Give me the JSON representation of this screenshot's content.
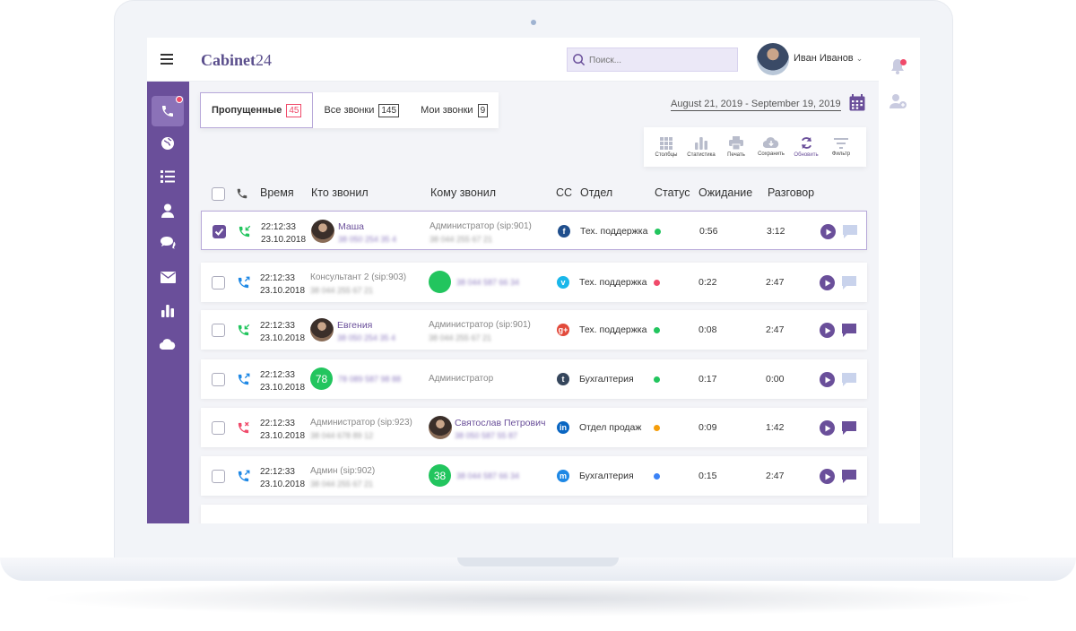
{
  "app": {
    "title": "Cabinet",
    "title_num": "24"
  },
  "search": {
    "placeholder": "Поиск..."
  },
  "user": {
    "name": "Иван Иванов"
  },
  "tabs": [
    {
      "label": "Пропущенные",
      "count": "45"
    },
    {
      "label": "Все звонки",
      "count": "145"
    },
    {
      "label": "Мои звонки",
      "count": "9"
    }
  ],
  "date_range": "August 21, 2019 - September 19, 2019",
  "toolbar": {
    "columns": "Столбцы",
    "stats": "Статистика",
    "print": "Печать",
    "save": "Сохранить",
    "refresh": "Обновить",
    "filter": "Фильтр"
  },
  "table": {
    "headers": {
      "time": "Время",
      "caller": "Кто звонил",
      "callee": "Кому звонил",
      "cc": "CC",
      "dept": "Отдел",
      "status": "Статус",
      "wait": "Ожидание",
      "talk": "Разговор"
    },
    "rows": [
      {
        "time": "22:12:33",
        "date": "23.10.2018",
        "caller_name": "Маша",
        "caller_phone": "38 050 254 35 4",
        "callee_name": "Администратор (sip:901)",
        "callee_phone": "38 044 255 67 21",
        "dept": "Тех. поддержка",
        "wait": "0:56",
        "talk": "3:12",
        "status_color": "#22c55e",
        "cc_color": "#1f4e8c",
        "cc_icon": "f",
        "direction": "incoming",
        "checked": true
      },
      {
        "time": "22:12:33",
        "date": "23.10.2018",
        "caller_name": "Консультант 2 (sip:903)",
        "caller_phone": "38 044 255 67 21",
        "callee_phone": "38 044 587 66 34",
        "dept": "Тех. поддержка",
        "wait": "0:22",
        "talk": "2:47",
        "status_color": "#f04a6a",
        "cc_color": "#1ab7ea",
        "cc_icon": "v",
        "direction": "outgoing",
        "checked": false
      },
      {
        "time": "22:12:33",
        "date": "23.10.2018",
        "caller_name": "Евгения",
        "caller_phone": "38 050 254 35 4",
        "callee_name": "Администратор (sip:901)",
        "callee_phone": "38 044 255 67 21",
        "dept": "Тех. поддержка",
        "wait": "0:08",
        "talk": "2:47",
        "status_color": "#22c55e",
        "cc_color": "#e24a3b",
        "cc_icon": "g+",
        "direction": "incoming",
        "checked": false
      },
      {
        "time": "22:12:33",
        "date": "23.10.2018",
        "caller_badge": "78",
        "caller_phone": "78 089 587 98 88",
        "callee_name": "Администратор",
        "dept": "Бухгалтерия",
        "wait": "0:17",
        "talk": "0:00",
        "status_color": "#22c55e",
        "cc_color": "#35465c",
        "cc_icon": "t",
        "direction": "outgoing",
        "checked": false
      },
      {
        "time": "22:12:33",
        "date": "23.10.2018",
        "caller_name": "Администратор (sip:923)",
        "caller_phone": "38 044 678 89 12",
        "callee_name": "Святослав Петрович",
        "callee_phone": "38 050 587 55 87",
        "dept": "Отдел продаж",
        "wait": "0:09",
        "talk": "1:42",
        "status_color": "#f59e0b",
        "cc_color": "#0a66c2",
        "cc_icon": "in",
        "direction": "missed",
        "checked": false
      },
      {
        "time": "22:12:33",
        "date": "23.10.2018",
        "caller_name": "Админ (sip:902)",
        "caller_phone": "38 044 255 67 21",
        "callee_badge": "38",
        "callee_phone": "38 044 587 66 34",
        "dept": "Бухгалтерия",
        "wait": "0:15",
        "talk": "2:47",
        "status_color": "#3b82f6",
        "cc_color": "#1e88e5",
        "cc_icon": "m",
        "direction": "outgoing",
        "checked": false
      }
    ]
  },
  "colors": {
    "accent": "#6a4f9a",
    "alert": "#f04a6a"
  }
}
